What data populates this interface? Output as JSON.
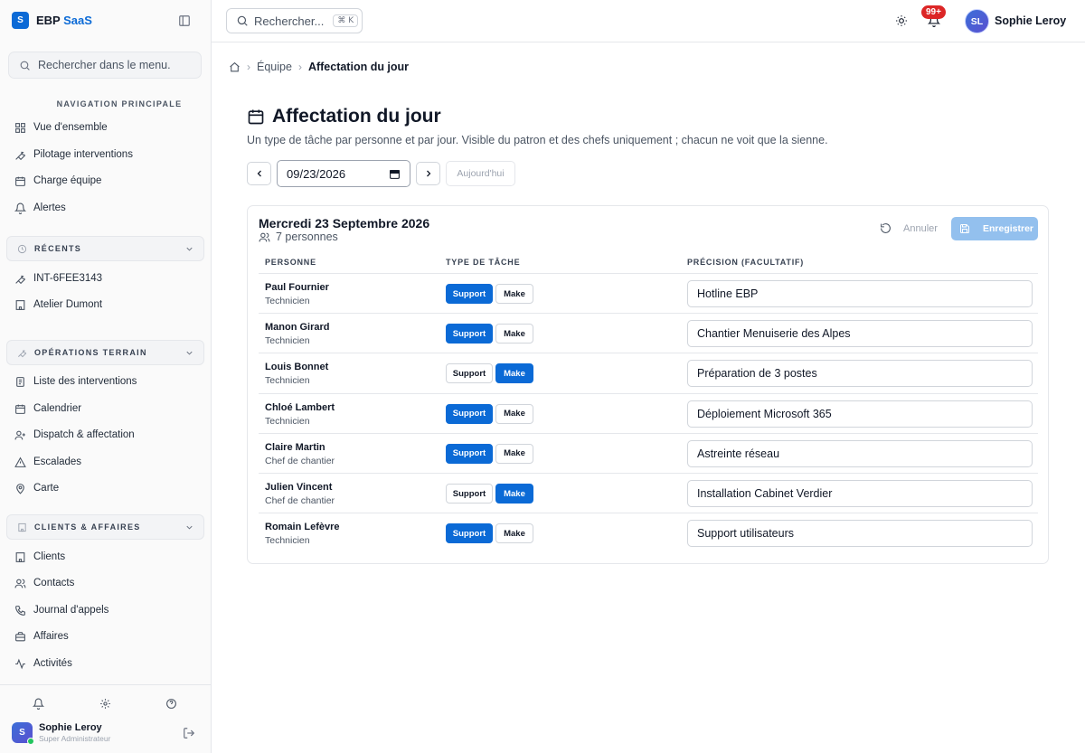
{
  "brand": {
    "logo": "S",
    "name": "EBP",
    "accent": "SaaS"
  },
  "sidebar": {
    "search_placeholder": "Rechercher dans le menu.",
    "main_heading": "NAVIGATION PRINCIPALE",
    "main_items": [
      {
        "label": "Vue d'ensemble",
        "icon": "grid-icon"
      },
      {
        "label": "Pilotage interventions",
        "icon": "wrench-icon"
      },
      {
        "label": "Charge équipe",
        "icon": "calendar-icon"
      },
      {
        "label": "Alertes",
        "icon": "bell-icon"
      }
    ],
    "groups": [
      {
        "title": "RÉCENTS",
        "icon": "clock-icon",
        "items": [
          {
            "label": "INT-6FEE3143",
            "icon": "wrench-icon"
          },
          {
            "label": "Atelier Dumont",
            "icon": "building-icon"
          }
        ]
      },
      {
        "title": "OPÉRATIONS TERRAIN",
        "icon": "wrench-icon",
        "items": [
          {
            "label": "Liste des interventions",
            "icon": "list-icon"
          },
          {
            "label": "Calendrier",
            "icon": "calendar-icon"
          },
          {
            "label": "Dispatch & affectation",
            "icon": "user-plus-icon"
          },
          {
            "label": "Escalades",
            "icon": "warning-icon"
          },
          {
            "label": "Carte",
            "icon": "map-pin-icon"
          }
        ]
      },
      {
        "title": "CLIENTS & AFFAIRES",
        "icon": "building-icon",
        "items": [
          {
            "label": "Clients",
            "icon": "building-icon"
          },
          {
            "label": "Contacts",
            "icon": "users-icon"
          },
          {
            "label": "Journal d'appels",
            "icon": "phone-icon"
          },
          {
            "label": "Affaires",
            "icon": "briefcase-icon"
          },
          {
            "label": "Activités",
            "icon": "activity-icon"
          }
        ]
      }
    ],
    "user": {
      "initial": "S",
      "name": "Sophie Leroy",
      "role": "Super Administrateur"
    }
  },
  "topbar": {
    "search_label": "Rechercher...",
    "shortcut": "⌘ K",
    "notif_count": "99+",
    "user_initials": "SL",
    "user_name": "Sophie Leroy"
  },
  "breadcrumb": {
    "section": "Équipe",
    "current": "Affectation du jour"
  },
  "page": {
    "title": "Affectation du jour",
    "subtitle": "Un type de tâche par personne et par jour. Visible du patron et des chefs uniquement ; chacun ne voit que la sienne.",
    "date_value": "09/23/2026",
    "today_label": "Aujourd'hui"
  },
  "card": {
    "title": "Mercredi 23 Septembre 2026",
    "count": "7 personnes",
    "cancel_label": "Annuler",
    "save_label": "Enregistrer",
    "columns": [
      "PERSONNE",
      "TYPE DE TÂCHE",
      "PRÉCISION (FACULTATIF)"
    ],
    "options": [
      "Support",
      "Make"
    ],
    "rows": [
      {
        "name": "Paul Fournier",
        "role": "Technicien",
        "task": "Support",
        "precision": "Hotline EBP"
      },
      {
        "name": "Manon Girard",
        "role": "Technicien",
        "task": "Support",
        "precision": "Chantier Menuiserie des Alpes"
      },
      {
        "name": "Louis Bonnet",
        "role": "Technicien",
        "task": "Make",
        "precision": "Préparation de 3 postes"
      },
      {
        "name": "Chloé Lambert",
        "role": "Technicien",
        "task": "Support",
        "precision": "Déploiement Microsoft 365"
      },
      {
        "name": "Claire Martin",
        "role": "Chef de chantier",
        "task": "Support",
        "precision": "Astreinte réseau"
      },
      {
        "name": "Julien Vincent",
        "role": "Chef de chantier",
        "task": "Make",
        "precision": "Installation Cabinet Verdier"
      },
      {
        "name": "Romain Lefèvre",
        "role": "Technicien",
        "task": "Support",
        "precision": "Support utilisateurs"
      }
    ]
  },
  "colors": {
    "accent": "#0b6ad6",
    "accent_disabled": "#93c0ee",
    "badge": "#dc2626"
  }
}
